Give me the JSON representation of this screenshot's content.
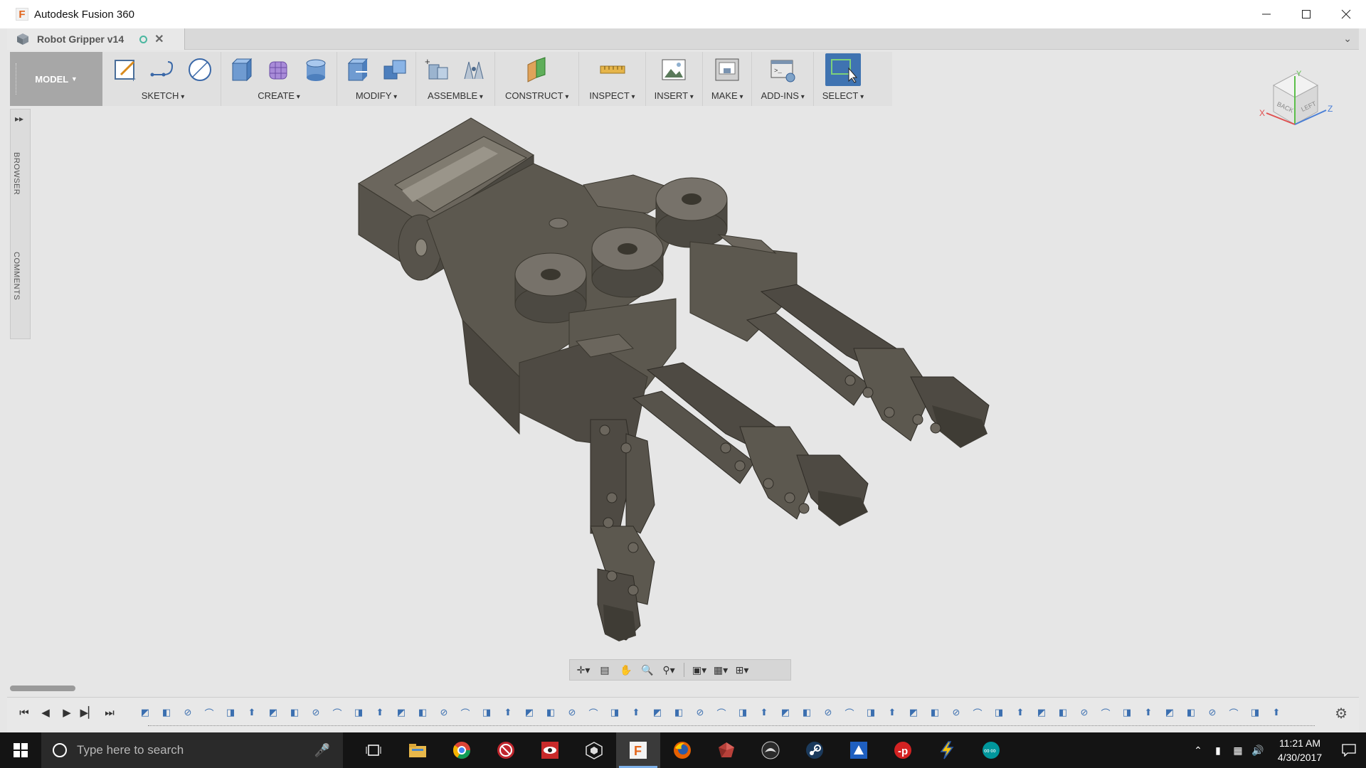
{
  "window": {
    "app_title": "Autodesk Fusion 360",
    "controls": [
      "minimize-icon",
      "maximize-icon",
      "close-icon"
    ]
  },
  "document_tab": {
    "title": "Robot Gripper v14",
    "status_icon": "sync-status-icon",
    "close_glyph": "✕"
  },
  "toolbar": {
    "workspace": "MODEL",
    "groups": [
      {
        "label": "SKETCH",
        "icons": [
          "create-sketch-icon",
          "line-icon",
          "circle-icon"
        ]
      },
      {
        "label": "CREATE",
        "icons": [
          "extrude-icon",
          "box-form-icon",
          "cylinder-icon"
        ]
      },
      {
        "label": "MODIFY",
        "icons": [
          "press-pull-icon",
          "combine-icon"
        ]
      },
      {
        "label": "ASSEMBLE",
        "icons": [
          "new-component-icon",
          "joint-icon"
        ]
      },
      {
        "label": "CONSTRUCT",
        "icons": [
          "offset-plane-icon"
        ]
      },
      {
        "label": "INSPECT",
        "icons": [
          "measure-icon"
        ]
      },
      {
        "label": "INSERT",
        "icons": [
          "insert-image-icon"
        ]
      },
      {
        "label": "MAKE",
        "icons": [
          "3d-print-icon"
        ]
      },
      {
        "label": "ADD-INS",
        "icons": [
          "scripts-addins-icon"
        ]
      },
      {
        "label": "SELECT",
        "icons": [
          "select-icon"
        ]
      }
    ]
  },
  "side_panel": {
    "expand_glyph": "▸▸",
    "browser_label": "BROWSER",
    "comments_label": "COMMENTS"
  },
  "viewcube": {
    "faces": [
      "BACK",
      "LEFT"
    ],
    "axes": [
      "X",
      "Y",
      "Z"
    ]
  },
  "navigation_bar": {
    "icons": [
      "orbit-icon",
      "look-at-icon",
      "pan-icon",
      "zoom-icon",
      "fit-icon",
      "display-settings-icon",
      "grid-icon",
      "viewports-icon"
    ]
  },
  "timeline": {
    "controls": [
      "⏮",
      "◀",
      "▶",
      "▶▏",
      "⏭"
    ],
    "feature_count": 54,
    "accent": "#3b6fb0"
  },
  "taskbar": {
    "search_placeholder": "Type here to search",
    "apps": [
      "file-explorer-icon",
      "chrome-icon",
      "blocked-app-icon",
      "eye-app-icon",
      "cube-app-icon",
      "fusion-360-icon",
      "firefox-icon",
      "red-gem-app-icon",
      "inkscape-icon",
      "steam-icon",
      "shape-app-icon",
      "p-app-icon",
      "lightning-app-icon",
      "arduino-icon"
    ],
    "time": "11:21 AM",
    "date": "4/30/2017"
  },
  "colors": {
    "model_body": "#57534b",
    "background": "#e6e6e6",
    "select_accent": "#3f73b1"
  }
}
